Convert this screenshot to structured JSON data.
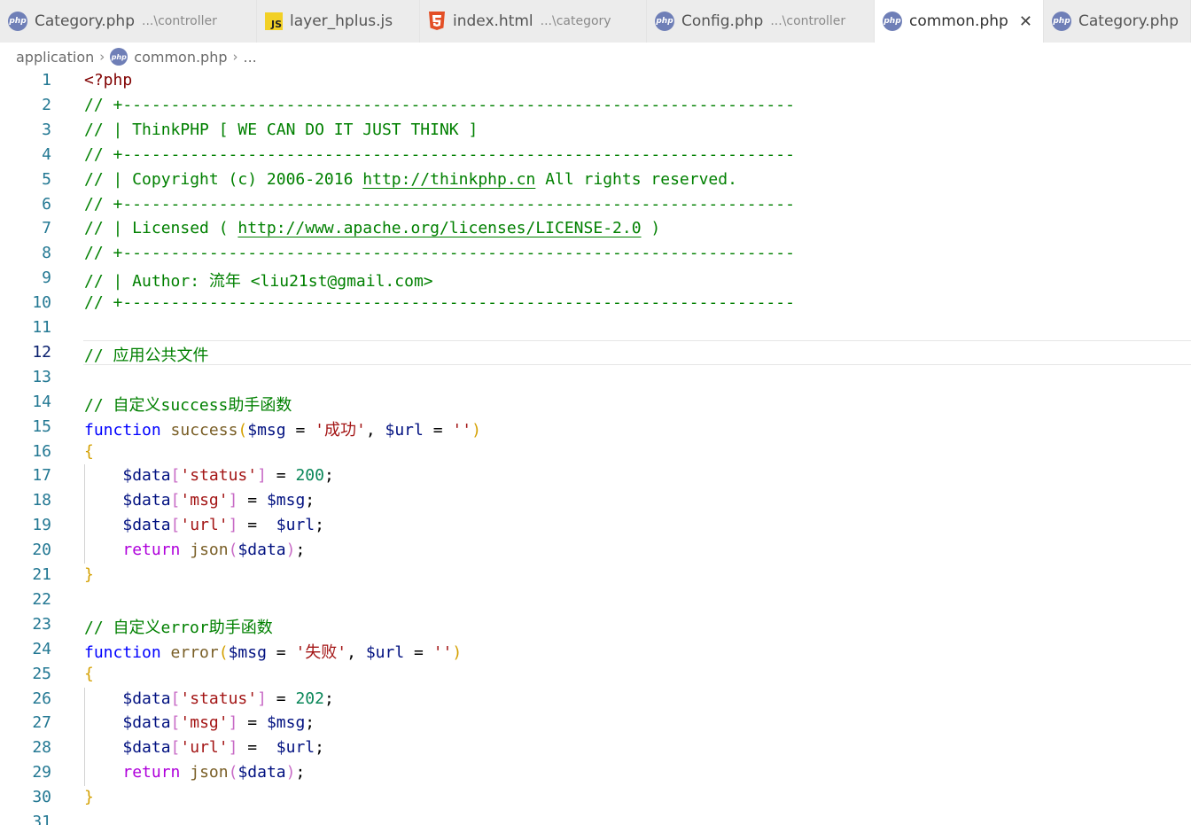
{
  "tabs": [
    {
      "icon": "php-icon",
      "title": "Category.php",
      "desc": "...\\controller",
      "active": false
    },
    {
      "icon": "js-icon",
      "title": "layer_hplus.js",
      "desc": "",
      "active": false
    },
    {
      "icon": "html5-icon",
      "title": "index.html",
      "desc": "...\\category",
      "active": false
    },
    {
      "icon": "php-icon",
      "title": "Config.php",
      "desc": "...\\controller",
      "active": false
    },
    {
      "icon": "php-icon",
      "title": "common.php",
      "desc": "",
      "active": true,
      "close": "✕"
    },
    {
      "icon": "php-icon",
      "title": "Category.php",
      "desc": "",
      "active": false
    }
  ],
  "breadcrumb": {
    "folder": "application",
    "file": "common.php",
    "more": "..."
  },
  "icon_label": "php",
  "js_icon_label": "JS",
  "editor": {
    "current_line": 12,
    "lines": [
      [
        [
          "tag",
          "<?php"
        ]
      ],
      [
        [
          "cmt",
          "// +----------------------------------------------------------------------"
        ]
      ],
      [
        [
          "cmt",
          "// | ThinkPHP [ WE CAN DO IT JUST THINK ]"
        ]
      ],
      [
        [
          "cmt",
          "// +----------------------------------------------------------------------"
        ]
      ],
      [
        [
          "cmt",
          "// | Copyright (c) 2006-2016 "
        ],
        [
          "link",
          "http://thinkphp.cn"
        ],
        [
          "cmt",
          " All rights reserved."
        ]
      ],
      [
        [
          "cmt",
          "// +----------------------------------------------------------------------"
        ]
      ],
      [
        [
          "cmt",
          "// | Licensed ( "
        ],
        [
          "link",
          "http://www.apache.org/licenses/LICENSE-2.0"
        ],
        [
          "cmt",
          " )"
        ]
      ],
      [
        [
          "cmt",
          "// +----------------------------------------------------------------------"
        ]
      ],
      [
        [
          "cmt",
          "// | Author: 流年 <liu21st@gmail.com>"
        ]
      ],
      [
        [
          "cmt",
          "// +----------------------------------------------------------------------"
        ]
      ],
      [],
      [
        [
          "cmt",
          "// 应用公共文件"
        ]
      ],
      [],
      [
        [
          "cmt",
          "// 自定义success助手函数"
        ]
      ],
      [
        [
          "kw",
          "function"
        ],
        [
          "op",
          " "
        ],
        [
          "fn",
          "success"
        ],
        [
          "b1",
          "("
        ],
        [
          "var",
          "$msg"
        ],
        [
          "op",
          " = "
        ],
        [
          "str",
          "'成功'"
        ],
        [
          "op",
          ", "
        ],
        [
          "var",
          "$url"
        ],
        [
          "op",
          " = "
        ],
        [
          "str",
          "''"
        ],
        [
          "b1",
          ")"
        ]
      ],
      [
        [
          "b1",
          "{"
        ]
      ],
      [
        [
          "op",
          "    "
        ],
        [
          "var",
          "$data"
        ],
        [
          "b2",
          "["
        ],
        [
          "str",
          "'status'"
        ],
        [
          "b2",
          "]"
        ],
        [
          "op",
          " = "
        ],
        [
          "num",
          "200"
        ],
        [
          "op",
          ";"
        ]
      ],
      [
        [
          "op",
          "    "
        ],
        [
          "var",
          "$data"
        ],
        [
          "b2",
          "["
        ],
        [
          "str",
          "'msg'"
        ],
        [
          "b2",
          "]"
        ],
        [
          "op",
          " = "
        ],
        [
          "var",
          "$msg"
        ],
        [
          "op",
          ";"
        ]
      ],
      [
        [
          "op",
          "    "
        ],
        [
          "var",
          "$data"
        ],
        [
          "b2",
          "["
        ],
        [
          "str",
          "'url'"
        ],
        [
          "b2",
          "]"
        ],
        [
          "op",
          " =  "
        ],
        [
          "var",
          "$url"
        ],
        [
          "op",
          ";"
        ]
      ],
      [
        [
          "op",
          "    "
        ],
        [
          "ctl",
          "return"
        ],
        [
          "op",
          " "
        ],
        [
          "fn",
          "json"
        ],
        [
          "b2",
          "("
        ],
        [
          "var",
          "$data"
        ],
        [
          "b2",
          ")"
        ],
        [
          "op",
          ";"
        ]
      ],
      [
        [
          "b1",
          "}"
        ]
      ],
      [],
      [
        [
          "cmt",
          "// 自定义error助手函数"
        ]
      ],
      [
        [
          "kw",
          "function"
        ],
        [
          "op",
          " "
        ],
        [
          "fn",
          "error"
        ],
        [
          "b1",
          "("
        ],
        [
          "var",
          "$msg"
        ],
        [
          "op",
          " = "
        ],
        [
          "str",
          "'失败'"
        ],
        [
          "op",
          ", "
        ],
        [
          "var",
          "$url"
        ],
        [
          "op",
          " = "
        ],
        [
          "str",
          "''"
        ],
        [
          "b1",
          ")"
        ]
      ],
      [
        [
          "b1",
          "{"
        ]
      ],
      [
        [
          "op",
          "    "
        ],
        [
          "var",
          "$data"
        ],
        [
          "b2",
          "["
        ],
        [
          "str",
          "'status'"
        ],
        [
          "b2",
          "]"
        ],
        [
          "op",
          " = "
        ],
        [
          "num",
          "202"
        ],
        [
          "op",
          ";"
        ]
      ],
      [
        [
          "op",
          "    "
        ],
        [
          "var",
          "$data"
        ],
        [
          "b2",
          "["
        ],
        [
          "str",
          "'msg'"
        ],
        [
          "b2",
          "]"
        ],
        [
          "op",
          " = "
        ],
        [
          "var",
          "$msg"
        ],
        [
          "op",
          ";"
        ]
      ],
      [
        [
          "op",
          "    "
        ],
        [
          "var",
          "$data"
        ],
        [
          "b2",
          "["
        ],
        [
          "str",
          "'url'"
        ],
        [
          "b2",
          "]"
        ],
        [
          "op",
          " =  "
        ],
        [
          "var",
          "$url"
        ],
        [
          "op",
          ";"
        ]
      ],
      [
        [
          "op",
          "    "
        ],
        [
          "ctl",
          "return"
        ],
        [
          "op",
          " "
        ],
        [
          "fn",
          "json"
        ],
        [
          "b2",
          "("
        ],
        [
          "var",
          "$data"
        ],
        [
          "b2",
          ")"
        ],
        [
          "op",
          ";"
        ]
      ],
      [
        [
          "b1",
          "}"
        ]
      ],
      []
    ]
  },
  "colors": {
    "comment": "#008000",
    "keyword": "#0000ff",
    "control": "#af00db",
    "function": "#795e26",
    "variable": "#001080",
    "string": "#a31515",
    "number": "#098658",
    "bracket_level1": "#d4a000",
    "bracket_level2": "#c86cc6",
    "line_number": "#237893",
    "php_icon": "#6f7fb7"
  }
}
